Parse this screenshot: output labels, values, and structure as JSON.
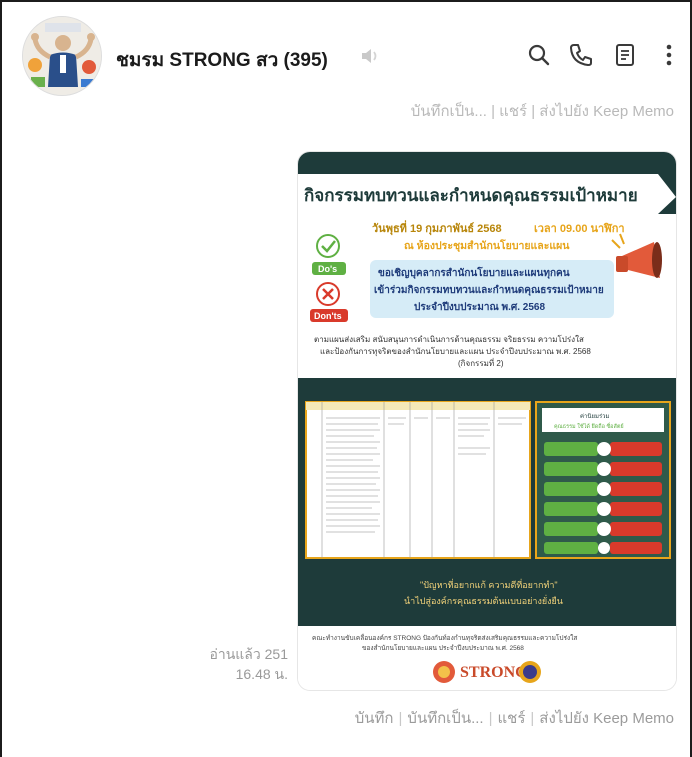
{
  "header": {
    "chat_name": "ชมรม STRONG สว (395)",
    "icons": [
      "avatar-image",
      "mute-icon",
      "search-icon",
      "phone-icon",
      "notes-icon",
      "more-icon"
    ]
  },
  "memo_actions_top": "บันทึกเป็น... | แชร์ | ส่งไปยัง Keep Memo",
  "message": {
    "read_status": "อ่านแล้ว 251",
    "time": "16.48 น.",
    "poster": {
      "title": "กิจกรรมทบทวนและกำหนดคุณธรรมเป้าหมาย",
      "date_line_prefix": "วันพุธที่ 19 กุมภาพันธ์ 2568",
      "time_line": "เวลา 09.00 นาฬิกา",
      "place": "ณ ห้องประชุมสำนักนโยบายและแผน",
      "dos": "Do's",
      "donts": "Don'ts",
      "invite_1": "ขอเชิญบุคลากรสำนักนโยบายและแผนทุกคน",
      "invite_2": "เข้าร่วมกิจกรรมทบทวนและกำหนดคุณธรรมเป้าหมาย",
      "invite_3": "ประจำปีงบประมาณ พ.ศ. 2568",
      "desc_1": "ตามแผนส่งเสริม สนับสนุนการดำเนินการด้านคุณธรรม จริยธรรม ความโปร่งใส",
      "desc_2": "และป้องกันการทุจริตของสำนักนโยบายและแผน ประจำปีงบประมาณ พ.ศ. 2568",
      "desc_3": "(กิจกรรมที่ 2)",
      "quote_1": "\"ปัญหาที่อยากแก้ ความดีที่อยากทำ\"",
      "quote_2": "นำไปสู่องค์กรคุณธรรมต้นแบบอย่างยั่งยืน",
      "footer_1": "คณะทำงานขับเคลื่อนองค์กร STRONG ปัองกันท์องกำนทุจริตส่งเสริมคุณธรรมและความโปร่งใส",
      "footer_2": "ของสำนักนโยบายและแผน ประจำปีงบประมาณ พ.ศ. 2568",
      "logo_text": "STRONG",
      "right_panel_title": "ค่านิยมร่วม",
      "right_panel_sub": "คุณธรรม ใช้ได้ ยึดถือ ซื่อสัตย์",
      "right_panel_labels": [
        "Do's",
        "Don'ts"
      ]
    },
    "actions": [
      "บันทึก",
      "บันทึกเป็น...",
      "แชร์",
      "ส่งไปยัง Keep Memo"
    ]
  },
  "colors": {
    "poster_dark": "#1e3b3a",
    "poster_title_bg": "#ffffff",
    "gold": "#e7a51b",
    "green": "#5fb043",
    "red": "#d93a2b",
    "blue_box": "#d6ecf7"
  }
}
